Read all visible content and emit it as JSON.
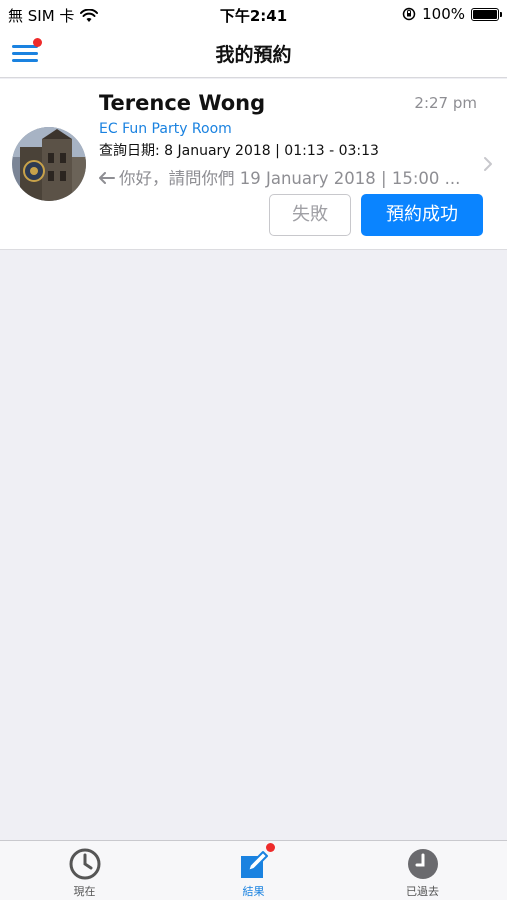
{
  "status_bar": {
    "carrier": "無 SIM 卡",
    "time": "下午2:41",
    "battery": "100%"
  },
  "nav": {
    "title": "我的預約"
  },
  "booking": {
    "name": "Terence Wong",
    "time": "2:27 pm",
    "room": "EC Fun Party Room",
    "date": "查詢日期: 8 January 2018 | 01:13 - 03:13",
    "message": "你好，請問你們 19 January 2018 | 15:00 ...",
    "fail_label": "失敗",
    "success_label": "預約成功"
  },
  "tabs": [
    {
      "label": "現在",
      "icon": "clock-icon"
    },
    {
      "label": "結果",
      "icon": "edit-icon"
    },
    {
      "label": "已過去",
      "icon": "history-clock-icon"
    }
  ],
  "colors": {
    "accent": "#0a84ff",
    "link": "#1a82e0",
    "badge": "#ee2b2b",
    "background": "#efeff4"
  }
}
